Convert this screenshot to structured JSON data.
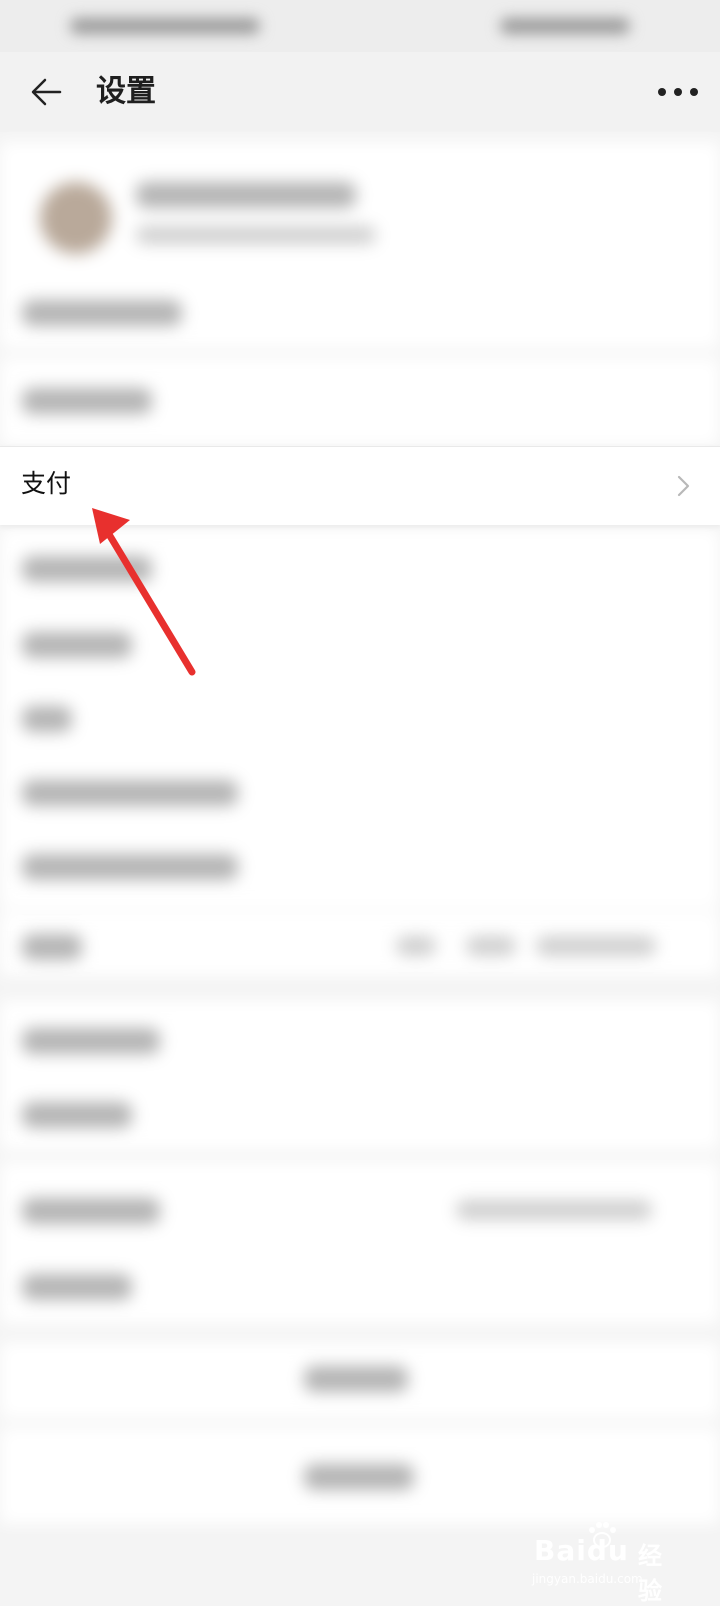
{
  "header": {
    "title": "设置"
  },
  "settings": {
    "highlighted_item": "支付"
  },
  "watermark": {
    "brand": "Baidu",
    "sub": "经验",
    "url": "jingyan.baidu.com"
  },
  "colors": {
    "arrow": "#e8302e",
    "background": "#f4f4f4",
    "row_background": "#ffffff"
  }
}
